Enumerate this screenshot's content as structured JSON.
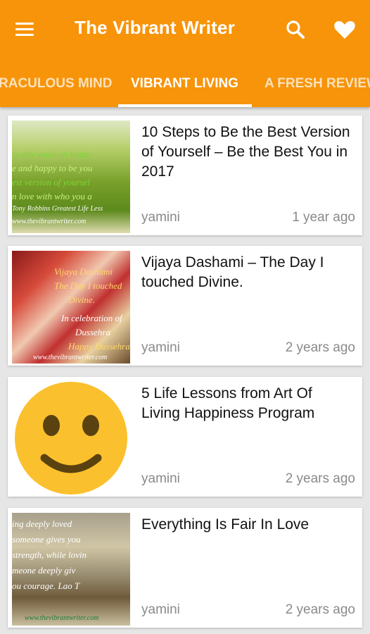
{
  "app": {
    "title": "The Vibrant Writer"
  },
  "toolbar": {
    "menu_icon": "hamburger-menu-icon",
    "search_icon": "search-icon",
    "favorite_icon": "heart-icon"
  },
  "tabs": [
    {
      "label": "RACULOUS MIND",
      "active": false
    },
    {
      "label": "VIBRANT LIVING",
      "active": true
    },
    {
      "label": "A FRESH REVIEW",
      "active": false
    }
  ],
  "colors": {
    "primary": "#f7940a",
    "text": "#111111",
    "muted": "#8a8a8a"
  },
  "posts": [
    {
      "title": "10 Steps to Be the Best Version of Yourself – Be the Best You in 2017",
      "author": "yamini",
      "time": "1 year ago",
      "thumb_lines": [
        "ry day wake up happy",
        "e and happy to be you",
        "est version of yoursel",
        "n love with who you a",
        "Tony Robbins Greatest Life Less",
        "www.thevibrantwriter.com"
      ]
    },
    {
      "title": "Vijaya Dashami – The Day I touched Divine.",
      "author": "yamini",
      "time": "2 years ago",
      "thumb_lines": [
        "Vijaya Dashami",
        "The Day I touched",
        "Divine.",
        "In celebration of",
        "Dussehra",
        "Happy Dussehra",
        "www.thevibrantwriter.com"
      ]
    },
    {
      "title": "5 Life Lessons from Art Of Living Happiness Program",
      "author": "yamini",
      "time": "2 years ago",
      "thumb_icon": "smiley-face-icon"
    },
    {
      "title": "Everything Is Fair In Love",
      "author": "yamini",
      "time": "2 years ago",
      "thumb_lines": [
        "ing deeply loved",
        "someone gives you",
        "strength, while lovin",
        "meone deeply giv",
        "ou courage. Lao T",
        "www.thevibrantwriter.com"
      ]
    }
  ]
}
